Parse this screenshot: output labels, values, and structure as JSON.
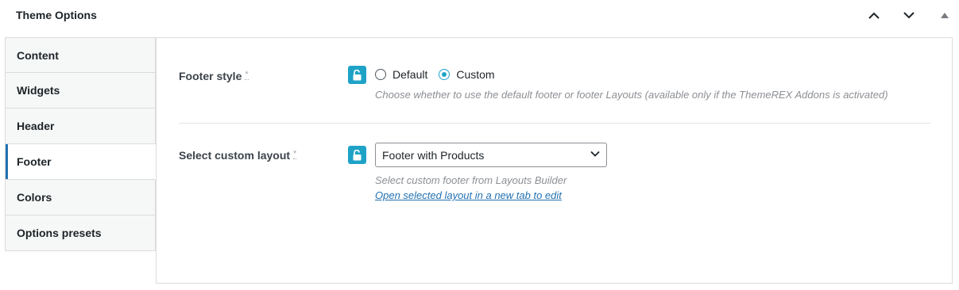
{
  "header": {
    "title": "Theme Options"
  },
  "sidebar": {
    "tabs": [
      {
        "label": "Content"
      },
      {
        "label": "Widgets"
      },
      {
        "label": "Header"
      },
      {
        "label": "Footer"
      },
      {
        "label": "Colors"
      },
      {
        "label": "Options presets"
      }
    ],
    "active": "Footer"
  },
  "footer_style": {
    "label": "Footer style",
    "required_mark": "*",
    "options": [
      {
        "label": "Default"
      },
      {
        "label": "Custom"
      }
    ],
    "selected": "Custom",
    "description": "Choose whether to use the default footer or footer Layouts (available only if the ThemeREX Addons is activated)"
  },
  "custom_layout": {
    "label": "Select custom layout",
    "required_mark": "*",
    "value": "Footer with Products",
    "description": "Select custom footer from Layouts Builder",
    "link": "Open selected layout in a new tab to edit"
  },
  "colors": {
    "accent": "#1ea3c7",
    "link": "#2271b1",
    "tab_active_bar": "#2271b1"
  },
  "icons": [
    "chevron-up-icon",
    "chevron-down-icon",
    "triangle-up-icon",
    "unlock-icon",
    "select-chevron-down-icon"
  ]
}
